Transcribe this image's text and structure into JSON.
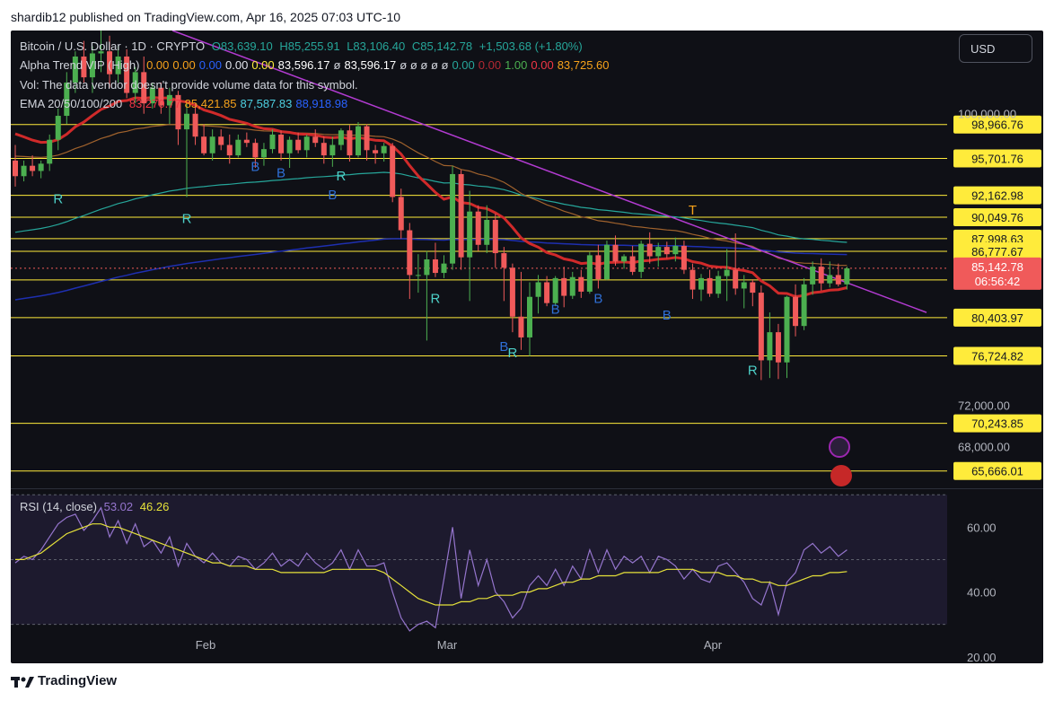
{
  "publisher_line": "shardib12 published on TradingView.com, Apr 16, 2025 07:03 UTC-10",
  "footer_brand": "TradingView",
  "currency_button": "USD",
  "legend": {
    "symbol": "Bitcoin / U.S. Dollar · 1D · CRYPTO",
    "open": "O83,639.10",
    "high": "H85,255.91",
    "low": "L83,106.40",
    "close": "C85,142.78",
    "change": "+1,503.68 (+1.80%)",
    "alpha_name": "Alpha Trend VIP (High)",
    "alpha_values": [
      {
        "text": "0.00",
        "color": "#f7a21b"
      },
      {
        "text": "0.00",
        "color": "#f7a21b"
      },
      {
        "text": "0.00",
        "color": "#2962ff"
      },
      {
        "text": "0.00",
        "color": "#e0e3eb"
      },
      {
        "text": "0.00",
        "color": "#ffeb3b"
      },
      {
        "text": "83,596.17",
        "color": "#ffffff"
      },
      {
        "text": "ø",
        "color": "#d1d4dc"
      },
      {
        "text": "83,596.17",
        "color": "#ffffff"
      },
      {
        "text": "ø ø ø ø ø",
        "color": "#d1d4dc"
      },
      {
        "text": "0.00",
        "color": "#26a69a"
      },
      {
        "text": "0.00",
        "color": "#b22833"
      },
      {
        "text": "1.00",
        "color": "#4caf50"
      },
      {
        "text": "0.00",
        "color": "#f23645"
      },
      {
        "text": "83,725.60",
        "color": "#f7a21b"
      }
    ],
    "vol_text": "Vol: The data vendor doesn't provide volume data for this symbol.",
    "ema_name": "EMA 20/50/100/200",
    "ema_values": [
      {
        "text": "83,270.77",
        "color": "#f23645"
      },
      {
        "text": "85,421.85",
        "color": "#f7a21b"
      },
      {
        "text": "87,587.83",
        "color": "#4dd0e1"
      },
      {
        "text": "88,918.98",
        "color": "#2962ff"
      }
    ],
    "rsi_name": "RSI (14, close)",
    "rsi_value": "53.02",
    "rsi_ma_value": "46.26"
  },
  "colors": {
    "up": "#4caf50",
    "down": "#f05a5a",
    "level": "#ffeb3b",
    "trendline": "#b23bd1",
    "ema20": "#d02a2a",
    "ema50": "#a0622d",
    "ema100": "#26a69a",
    "ema200": "#1e2fb0",
    "rsi": "#9575cd",
    "rsi_ma": "#e6e23a"
  },
  "chart_data": {
    "type": "candlestick",
    "title": "Bitcoin / U.S. Dollar · 1D · CRYPTO",
    "x_ticks": [
      "Feb",
      "Mar",
      "Apr"
    ],
    "y_ticks": [
      "100,000.00",
      "72,000.00",
      "68,000.00"
    ],
    "y_range": [
      64000,
      108000
    ],
    "horizontal_levels": [
      "98,966.76",
      "95,701.76",
      "92,162.98",
      "90,049.76",
      "87,998.63",
      "86,777.67",
      "84,028.67",
      "80,403.97",
      "76,724.82",
      "70,243.85",
      "65,666.01"
    ],
    "last_price_label": "85,142.78",
    "countdown_label": "06:56:42",
    "signals": [
      {
        "label": "R",
        "date_index": 5,
        "price": 91400
      },
      {
        "label": "R",
        "date_index": 20,
        "price": 89500
      },
      {
        "label": "B",
        "date_index": 28,
        "price": 94500
      },
      {
        "label": "B",
        "date_index": 31,
        "price": 93900
      },
      {
        "label": "R",
        "date_index": 38,
        "price": 93600
      },
      {
        "label": "B",
        "date_index": 37,
        "price": 91800
      },
      {
        "label": "R",
        "date_index": 49,
        "price": 81800
      },
      {
        "label": "B",
        "date_index": 57,
        "price": 77200
      },
      {
        "label": "R",
        "date_index": 58,
        "price": 76600
      },
      {
        "label": "B",
        "date_index": 63,
        "price": 80800
      },
      {
        "label": "B",
        "date_index": 68,
        "price": 81800
      },
      {
        "label": "B",
        "date_index": 76,
        "price": 80200
      },
      {
        "label": "T",
        "date_index": 79,
        "price": 90300
      },
      {
        "label": "R",
        "date_index": 86,
        "price": 74900
      }
    ],
    "candles": [
      {
        "o": 95500,
        "h": 97000,
        "l": 93000,
        "c": 94000
      },
      {
        "o": 94000,
        "h": 95500,
        "l": 93500,
        "c": 95000
      },
      {
        "o": 95000,
        "h": 96000,
        "l": 94000,
        "c": 94500
      },
      {
        "o": 94500,
        "h": 95500,
        "l": 93800,
        "c": 95200
      },
      {
        "o": 95200,
        "h": 98000,
        "l": 94500,
        "c": 97500
      },
      {
        "o": 97500,
        "h": 100500,
        "l": 96500,
        "c": 99800
      },
      {
        "o": 99800,
        "h": 104000,
        "l": 99000,
        "c": 103000
      },
      {
        "o": 103000,
        "h": 106000,
        "l": 102000,
        "c": 105500
      },
      {
        "o": 105500,
        "h": 107000,
        "l": 103000,
        "c": 103500
      },
      {
        "o": 103500,
        "h": 106500,
        "l": 102000,
        "c": 105800
      },
      {
        "o": 105800,
        "h": 108000,
        "l": 104000,
        "c": 106000
      },
      {
        "o": 106000,
        "h": 107500,
        "l": 102500,
        "c": 103800
      },
      {
        "o": 103800,
        "h": 106500,
        "l": 103000,
        "c": 105500
      },
      {
        "o": 105500,
        "h": 106200,
        "l": 101500,
        "c": 102000
      },
      {
        "o": 102000,
        "h": 104500,
        "l": 101000,
        "c": 104000
      },
      {
        "o": 104000,
        "h": 105500,
        "l": 100000,
        "c": 101000
      },
      {
        "o": 101000,
        "h": 103000,
        "l": 100500,
        "c": 102500
      },
      {
        "o": 102500,
        "h": 103000,
        "l": 100000,
        "c": 100800
      },
      {
        "o": 100800,
        "h": 102500,
        "l": 99000,
        "c": 101800
      },
      {
        "o": 101800,
        "h": 102200,
        "l": 97000,
        "c": 98500
      },
      {
        "o": 98500,
        "h": 101000,
        "l": 92000,
        "c": 100000
      },
      {
        "o": 100000,
        "h": 101000,
        "l": 97000,
        "c": 97800
      },
      {
        "o": 97800,
        "h": 99000,
        "l": 96000,
        "c": 96200
      },
      {
        "o": 96200,
        "h": 98500,
        "l": 95500,
        "c": 97800
      },
      {
        "o": 97800,
        "h": 98500,
        "l": 96500,
        "c": 97000
      },
      {
        "o": 97000,
        "h": 98000,
        "l": 95200,
        "c": 96000
      },
      {
        "o": 96000,
        "h": 98000,
        "l": 95800,
        "c": 97500
      },
      {
        "o": 97500,
        "h": 98200,
        "l": 96800,
        "c": 97200
      },
      {
        "o": 97200,
        "h": 97600,
        "l": 94800,
        "c": 95800
      },
      {
        "o": 95800,
        "h": 97200,
        "l": 95000,
        "c": 96600
      },
      {
        "o": 96600,
        "h": 98500,
        "l": 96200,
        "c": 98000
      },
      {
        "o": 98000,
        "h": 98400,
        "l": 95500,
        "c": 96200
      },
      {
        "o": 96200,
        "h": 97800,
        "l": 94800,
        "c": 97500
      },
      {
        "o": 97500,
        "h": 98200,
        "l": 96200,
        "c": 96500
      },
      {
        "o": 96500,
        "h": 98000,
        "l": 95800,
        "c": 97800
      },
      {
        "o": 97800,
        "h": 98500,
        "l": 96800,
        "c": 97200
      },
      {
        "o": 97200,
        "h": 97800,
        "l": 95200,
        "c": 96000
      },
      {
        "o": 96000,
        "h": 97800,
        "l": 94900,
        "c": 97000
      },
      {
        "o": 97000,
        "h": 98600,
        "l": 96500,
        "c": 98400
      },
      {
        "o": 98400,
        "h": 98900,
        "l": 95400,
        "c": 96000
      },
      {
        "o": 96000,
        "h": 99200,
        "l": 95800,
        "c": 98800
      },
      {
        "o": 98800,
        "h": 99000,
        "l": 95500,
        "c": 96500
      },
      {
        "o": 96500,
        "h": 97000,
        "l": 95200,
        "c": 96200
      },
      {
        "o": 96200,
        "h": 97200,
        "l": 95400,
        "c": 96900
      },
      {
        "o": 96900,
        "h": 97200,
        "l": 91500,
        "c": 92000
      },
      {
        "o": 92000,
        "h": 92800,
        "l": 88000,
        "c": 88800
      },
      {
        "o": 88800,
        "h": 89500,
        "l": 82200,
        "c": 84500
      },
      {
        "o": 84500,
        "h": 86500,
        "l": 82800,
        "c": 84500
      },
      {
        "o": 84500,
        "h": 86800,
        "l": 78200,
        "c": 86000
      },
      {
        "o": 86000,
        "h": 87600,
        "l": 84300,
        "c": 84700
      },
      {
        "o": 84700,
        "h": 86400,
        "l": 84200,
        "c": 85600
      },
      {
        "o": 85600,
        "h": 95000,
        "l": 85000,
        "c": 94200
      },
      {
        "o": 94200,
        "h": 94600,
        "l": 85000,
        "c": 86200
      },
      {
        "o": 86200,
        "h": 92600,
        "l": 82000,
        "c": 90600
      },
      {
        "o": 90600,
        "h": 91200,
        "l": 86800,
        "c": 87400
      },
      {
        "o": 87400,
        "h": 91200,
        "l": 86600,
        "c": 89800
      },
      {
        "o": 89800,
        "h": 90400,
        "l": 85200,
        "c": 86600
      },
      {
        "o": 86600,
        "h": 87200,
        "l": 82000,
        "c": 85200
      },
      {
        "o": 85200,
        "h": 85600,
        "l": 79000,
        "c": 80500
      },
      {
        "o": 80500,
        "h": 84800,
        "l": 77300,
        "c": 78500
      },
      {
        "o": 78500,
        "h": 83800,
        "l": 76700,
        "c": 82400
      },
      {
        "o": 82400,
        "h": 84500,
        "l": 80800,
        "c": 83800
      },
      {
        "o": 83800,
        "h": 84400,
        "l": 81500,
        "c": 81800
      },
      {
        "o": 81800,
        "h": 84400,
        "l": 81500,
        "c": 84200
      },
      {
        "o": 84200,
        "h": 85300,
        "l": 81400,
        "c": 82500
      },
      {
        "o": 82500,
        "h": 84800,
        "l": 82200,
        "c": 84300
      },
      {
        "o": 84300,
        "h": 85000,
        "l": 82300,
        "c": 82900
      },
      {
        "o": 82900,
        "h": 86700,
        "l": 82700,
        "c": 86400
      },
      {
        "o": 86400,
        "h": 87400,
        "l": 83200,
        "c": 84100
      },
      {
        "o": 84100,
        "h": 87800,
        "l": 84000,
        "c": 87400
      },
      {
        "o": 87400,
        "h": 88300,
        "l": 85400,
        "c": 85800
      },
      {
        "o": 85800,
        "h": 86500,
        "l": 85100,
        "c": 86300
      },
      {
        "o": 86300,
        "h": 87300,
        "l": 84500,
        "c": 84800
      },
      {
        "o": 84800,
        "h": 87800,
        "l": 84200,
        "c": 87500
      },
      {
        "o": 87500,
        "h": 88600,
        "l": 85600,
        "c": 86300
      },
      {
        "o": 86300,
        "h": 87600,
        "l": 85300,
        "c": 87200
      },
      {
        "o": 87200,
        "h": 87700,
        "l": 86100,
        "c": 86500
      },
      {
        "o": 86500,
        "h": 88100,
        "l": 85800,
        "c": 87300
      },
      {
        "o": 87300,
        "h": 87800,
        "l": 84600,
        "c": 85000
      },
      {
        "o": 85000,
        "h": 85600,
        "l": 82200,
        "c": 83100
      },
      {
        "o": 83100,
        "h": 84600,
        "l": 82000,
        "c": 84200
      },
      {
        "o": 84200,
        "h": 85000,
        "l": 82400,
        "c": 82700
      },
      {
        "o": 82700,
        "h": 84900,
        "l": 82300,
        "c": 84400
      },
      {
        "o": 84400,
        "h": 87000,
        "l": 82000,
        "c": 85000
      },
      {
        "o": 85000,
        "h": 88500,
        "l": 82600,
        "c": 83200
      },
      {
        "o": 83200,
        "h": 84500,
        "l": 81300,
        "c": 83800
      },
      {
        "o": 83800,
        "h": 84100,
        "l": 81500,
        "c": 82800
      },
      {
        "o": 82800,
        "h": 83500,
        "l": 74400,
        "c": 76300
      },
      {
        "o": 76300,
        "h": 80900,
        "l": 74600,
        "c": 79000
      },
      {
        "o": 79000,
        "h": 79800,
        "l": 74500,
        "c": 76100
      },
      {
        "o": 76100,
        "h": 82500,
        "l": 74600,
        "c": 82400
      },
      {
        "o": 82400,
        "h": 83600,
        "l": 78600,
        "c": 79600
      },
      {
        "o": 79600,
        "h": 84200,
        "l": 79200,
        "c": 83600
      },
      {
        "o": 83600,
        "h": 85800,
        "l": 82600,
        "c": 85300
      },
      {
        "o": 85300,
        "h": 86100,
        "l": 83000,
        "c": 83700
      },
      {
        "o": 83700,
        "h": 85800,
        "l": 83300,
        "c": 84500
      },
      {
        "o": 84500,
        "h": 85600,
        "l": 83400,
        "c": 83600
      },
      {
        "o": 83600,
        "h": 85300,
        "l": 83100,
        "c": 85143
      }
    ],
    "rsi": {
      "name": "RSI (14, close)",
      "y_ticks": [
        "60.00",
        "40.00",
        "20.00"
      ],
      "y_range": [
        18,
        72
      ],
      "rsi_values": [
        49,
        51,
        50,
        53,
        57,
        61,
        63,
        64,
        59,
        62,
        66,
        57,
        62,
        55,
        61,
        54,
        56,
        52,
        57,
        48,
        55,
        51,
        49,
        52,
        49,
        48,
        51,
        50,
        47,
        49,
        52,
        48,
        50,
        48,
        52,
        49,
        47,
        49,
        53,
        47,
        53,
        48,
        48,
        49,
        40,
        32,
        28,
        30,
        31,
        29,
        44,
        60,
        38,
        53,
        42,
        50,
        40,
        37,
        32,
        35,
        42,
        45,
        42,
        47,
        42,
        48,
        44,
        53,
        46,
        53,
        47,
        51,
        49,
        51,
        46,
        51,
        50,
        48,
        44,
        47,
        44,
        43,
        48,
        49,
        46,
        43,
        38,
        36,
        43,
        33,
        43,
        46,
        53,
        55,
        52,
        54,
        51,
        53
      ],
      "ma_values": [
        50,
        50,
        51,
        52,
        54,
        56,
        58,
        59,
        60,
        61,
        61,
        60,
        60,
        59,
        58,
        57,
        56,
        55,
        54,
        53,
        52,
        51,
        50,
        49,
        49,
        48,
        48,
        48,
        47,
        47,
        47,
        46,
        46,
        46,
        46,
        46,
        46,
        47,
        47,
        47,
        47,
        47,
        47,
        46,
        44,
        42,
        40,
        38,
        37,
        36,
        36,
        36,
        37,
        37,
        38,
        38,
        39,
        39,
        39,
        40,
        40,
        41,
        41,
        42,
        43,
        43,
        44,
        44,
        45,
        45,
        45,
        46,
        46,
        46,
        46,
        46,
        47,
        47,
        47,
        47,
        46,
        46,
        46,
        45,
        45,
        44,
        44,
        43,
        43,
        42,
        42,
        43,
        44,
        45,
        45,
        46,
        46,
        46.3
      ]
    }
  }
}
